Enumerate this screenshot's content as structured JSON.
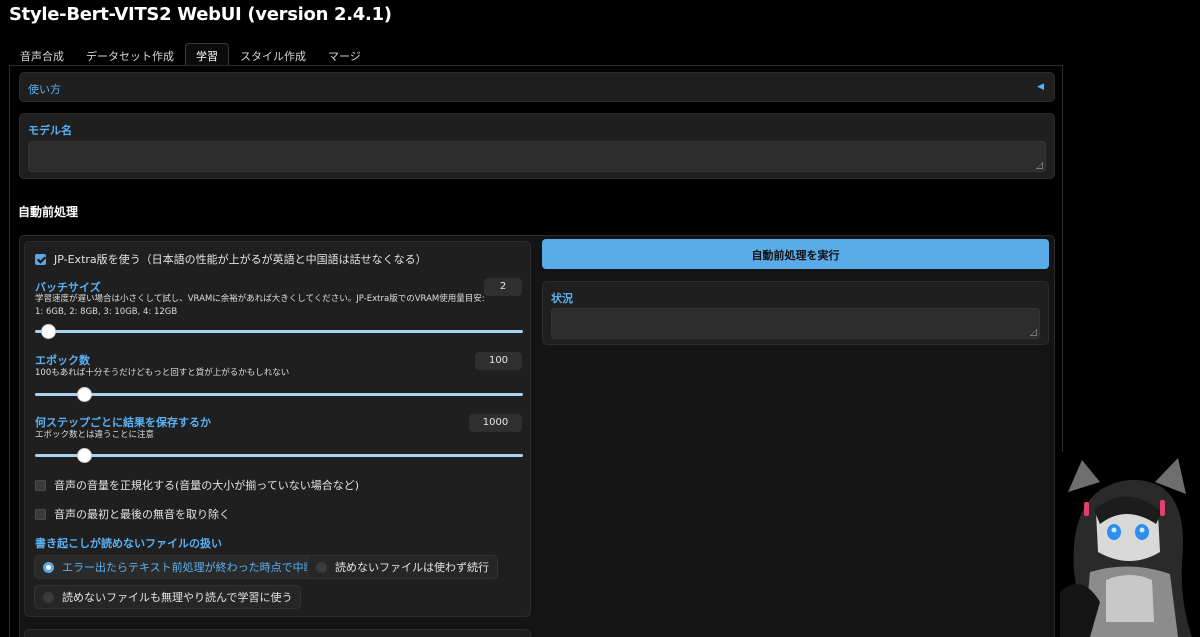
{
  "app": {
    "title": "Style-Bert-VITS2 WebUI (version 2.4.1)"
  },
  "tabs": [
    {
      "label": "音声合成"
    },
    {
      "label": "データセット作成"
    },
    {
      "label": "学習"
    },
    {
      "label": "スタイル作成"
    },
    {
      "label": "マージ"
    }
  ],
  "active_tab": "学習",
  "accordion": {
    "label": "使い方",
    "caret": "◀"
  },
  "model_name": {
    "label": "モデル名",
    "value": ""
  },
  "auto_preprocess": {
    "title": "自動前処理",
    "jp_extra": {
      "label": "JP-Extra版を使う（日本語の性能が上がるが英語と中国語は話せなくなる）",
      "checked": true
    },
    "batch_size": {
      "label": "バッチサイズ",
      "info_line1": "学習速度が遅い場合は小さくして試し、VRAMに余裕があれば大きくしてください。JP-Extra版でのVRAM使用量目安:",
      "info_line2": "1: 6GB, 2: 8GB, 3: 10GB, 4: 12GB",
      "value": "2",
      "fraction": 0.03
    },
    "epochs": {
      "label": "エポック数",
      "info": "100もあれば十分そうだけどもっと回すと質が上がるかもしれない",
      "value": "100",
      "fraction": 0.1
    },
    "save_every_steps": {
      "label": "何ステップごとに結果を保存するか",
      "info": "エポック数とは違うことに注意",
      "value": "1000",
      "fraction": 0.1
    },
    "normalize": {
      "label": "音声の音量を正規化する(音量の大小が揃っていない場合など)",
      "checked": false
    },
    "trim": {
      "label": "音声の最初と最後の無音を取り除く",
      "checked": false
    },
    "unreadable": {
      "label": "書き起こしが読めないファイルの扱い",
      "options": [
        {
          "label": "エラー出たらテキスト前処理が終わった時点で中断",
          "selected": true
        },
        {
          "label": "読めないファイルは使わず続行",
          "selected": false
        },
        {
          "label": "読めないファイルも無理やり読んで学習に使う",
          "selected": false
        }
      ]
    },
    "run_button": "自動前処理を実行",
    "status": {
      "label": "状況",
      "value": ""
    }
  },
  "colors": {
    "accent": "#5ab0f2",
    "button": "#5aace8",
    "panel": "#1f1f1f",
    "background": "#000000"
  },
  "mascot": {
    "icon": "anime-character-image"
  }
}
